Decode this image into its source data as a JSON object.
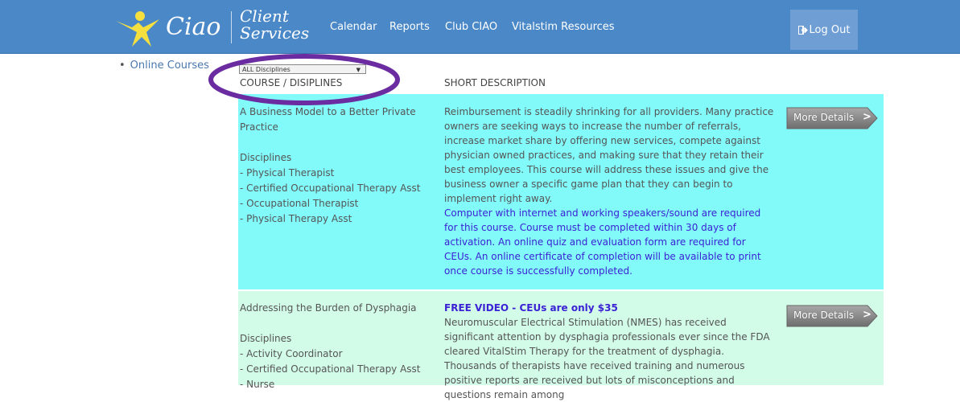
{
  "navbar": {
    "logo_text": "Ciao",
    "brand_line1": "Client",
    "brand_line2": "Services",
    "items": [
      "Calendar",
      "Reports",
      "Club CIAO",
      "Vitalstim Resources"
    ],
    "logout_label": "Log Out",
    "logout_icon": "sign-out-icon"
  },
  "sidebar": {
    "items": [
      "Online Courses"
    ]
  },
  "filter": {
    "selected": "ALL Disciplines"
  },
  "table": {
    "col_course": "COURSE / DISIPLINES",
    "col_desc": "SHORT DESCRIPTION",
    "more_label": "More Details",
    "rows": [
      {
        "title": "A Business Model to a Better Private Practice",
        "disciplines_label": "Disciplines",
        "disciplines": [
          "- Physical Therapist",
          "- Certified Occupational Therapy Asst",
          "- Occupational Therapist",
          "- Physical Therapy Asst"
        ],
        "description": "Reimbursement is steadily shrinking for all providers. Many practice owners are seeking ways to increase the number of referrals, increase market share by offering new services, compete against physician owned practices, and making sure that they retain their best employees. This course will address these issues and give the business owner a specific game plan that they can begin to implement right away.",
        "note": "Computer with internet and working speakers/sound are required for this course. Course must be completed within 30 days of activation. An online quiz and evaluation form are required for CEUs. An online certificate of completion will be available to print once course is successfully completed.",
        "bg": "#82fafa"
      },
      {
        "title": "Addressing the Burden of Dysphagia",
        "disciplines_label": "Disciplines",
        "disciplines": [
          "- Activity Coordinator",
          "- Certified Occupational Therapy Asst",
          "- Nurse"
        ],
        "free_note": "FREE VIDEO - CEUs are only $35",
        "description": "Neuromuscular Electrical Stimulation (NMES) has received significant attention by dysphagia professionals ever since the FDA cleared VitalStim Therapy for the treatment of dysphagia. Thousands of therapists have received training and numerous positive reports are received but lots of misconceptions and questions remain among",
        "bg": "#d2fbe8"
      }
    ]
  },
  "colors": {
    "navbar": "#4a88c8",
    "annotation": "#6a2ca0"
  }
}
